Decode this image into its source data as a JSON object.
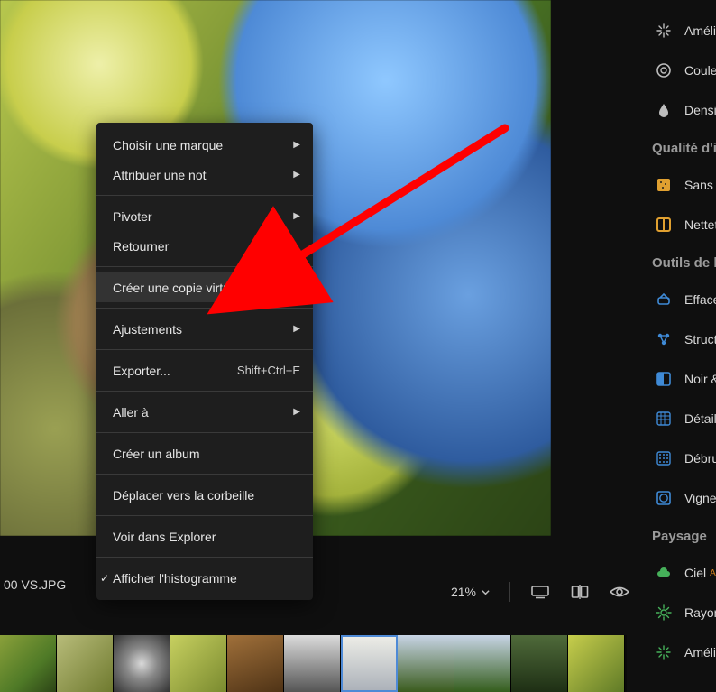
{
  "filename": "00 VS.JPG",
  "zoom_percent": "21%",
  "context_menu": {
    "items": [
      {
        "label": "Choisir une marque",
        "submenu": true
      },
      {
        "label": "Attribuer une not",
        "submenu": true
      },
      {
        "sep": true
      },
      {
        "label": "Pivoter",
        "submenu": true
      },
      {
        "label": "Retourner"
      },
      {
        "sep": true
      },
      {
        "label": "Créer une copie virtuelle",
        "shortcut": "Ctrl + '",
        "highlighted": true
      },
      {
        "sep": true
      },
      {
        "label": "Ajustements",
        "submenu": true
      },
      {
        "sep": true
      },
      {
        "label": "Exporter...",
        "shortcut": "Shift+Ctrl+E"
      },
      {
        "sep": true
      },
      {
        "label": "Aller à",
        "submenu": true
      },
      {
        "sep": true
      },
      {
        "label": "Créer un album"
      },
      {
        "sep": true
      },
      {
        "label": "Déplacer vers la corbeille"
      },
      {
        "sep": true
      },
      {
        "label": "Voir dans Explorer"
      },
      {
        "sep": true
      },
      {
        "label": "Afficher l'histogramme",
        "checked": true
      }
    ]
  },
  "sidebar": {
    "top_items": [
      {
        "label": "Amélio",
        "icon": "sparkle-icon"
      },
      {
        "label": "Couleur",
        "icon": "color-wheel-icon"
      },
      {
        "label": "Densité",
        "icon": "droplet-icon"
      }
    ],
    "groups": [
      {
        "title": "Qualité d'i",
        "items": [
          {
            "label": "Sans br",
            "icon": "noise-off-icon",
            "color": "#e0a030"
          },
          {
            "label": "Netteté",
            "icon": "sharpen-icon",
            "color": "#e0a030"
          }
        ]
      },
      {
        "title": "Outils de b",
        "items": [
          {
            "label": "Effacer",
            "icon": "eraser-icon",
            "color": "#3f8ad6"
          },
          {
            "label": "Structure",
            "icon": "structure-icon",
            "color": "#3f8ad6"
          },
          {
            "label": "Noir &",
            "icon": "bw-icon",
            "color": "#3f8ad6"
          },
          {
            "label": "Détails",
            "icon": "details-icon",
            "color": "#3f8ad6"
          },
          {
            "label": "Débruit",
            "icon": "denoise-icon",
            "color": "#3f8ad6"
          },
          {
            "label": "Vignet",
            "icon": "vignette-icon",
            "color": "#3f8ad6"
          }
        ]
      },
      {
        "title": "Paysage",
        "items": [
          {
            "label": "Ciel",
            "icon": "cloud-icon",
            "color": "#46b05a",
            "ai": true
          },
          {
            "label": "Rayons",
            "icon": "rays-icon",
            "color": "#46b05a"
          },
          {
            "label": "Amélio",
            "icon": "sparkle-icon",
            "color": "#46b05a"
          }
        ]
      }
    ]
  },
  "thumbnails": [
    {
      "bg": "linear-gradient(135deg,#8aa03a,#4f7a27 60%,#2c4416)"
    },
    {
      "bg": "linear-gradient(135deg,#b8bc7a,#6f7a2f)"
    },
    {
      "bg": "radial-gradient(circle at 50% 50%, #d9d9d9 0%, #888 40%, #333 100%)"
    },
    {
      "bg": "linear-gradient(135deg,#c7d060,#7a8a2f)"
    },
    {
      "bg": "linear-gradient(160deg,#a0703a,#4f3316)"
    },
    {
      "bg": "linear-gradient(180deg,#dcdcdc,#555)"
    },
    {
      "bg": "linear-gradient(180deg,#eeeee8,#aab0b8)",
      "selected": true
    },
    {
      "bg": "linear-gradient(180deg,#c8d5e6,#3a5b1d)"
    },
    {
      "bg": "linear-gradient(180deg,#c8d5e6,#345d1c)"
    },
    {
      "bg": "linear-gradient(180deg,#4f6a3a,#1e2f14)"
    },
    {
      "bg": "linear-gradient(135deg,#c7ce4c,#5f7a27)"
    }
  ]
}
